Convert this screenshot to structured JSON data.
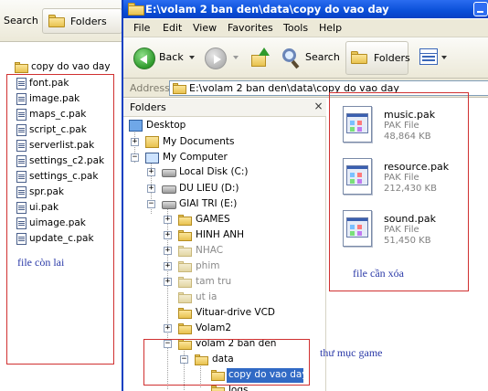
{
  "left_window": {
    "search_label": "Search",
    "folders_label": "Folders",
    "header_item": "copy do vao day",
    "files": [
      "font.pak",
      "image.pak",
      "maps_c.pak",
      "script_c.pak",
      "serverlist.pak",
      "settings_c2.pak",
      "settings_c.pak",
      "spr.pak",
      "ui.pak",
      "uimage.pak",
      "update_c.pak"
    ],
    "annotation": "file còn lai"
  },
  "main_window": {
    "title": "E:\\volam 2 ban den\\data\\copy do vao day",
    "menu": [
      "File",
      "Edit",
      "View",
      "Favorites",
      "Tools",
      "Help"
    ],
    "toolbar": {
      "back_label": "Back",
      "search_label": "Search",
      "folders_label": "Folders"
    },
    "address": {
      "label": "Address",
      "value": "E:\\volam 2 ban den\\data\\copy do vao day"
    },
    "folders_pane": {
      "title": "Folders",
      "close_glyph": "×",
      "tree": [
        {
          "label": "Desktop"
        },
        {
          "label": "My Documents"
        },
        {
          "label": "My Computer"
        },
        {
          "label": "Local Disk (C:)"
        },
        {
          "label": "DU LIEU (D:)"
        },
        {
          "label": "GIAI TRI (E:)"
        },
        {
          "label": "GAMES"
        },
        {
          "label": "HINH ANH"
        },
        {
          "label": "NHAC"
        },
        {
          "label": "phim"
        },
        {
          "label": "tam tru"
        },
        {
          "label": "ut ia"
        },
        {
          "label": "Vituar-drive VCD"
        },
        {
          "label": "Volam2"
        },
        {
          "label": "volam 2 ban den"
        },
        {
          "label": "data"
        },
        {
          "label": "copy do vao day"
        },
        {
          "label": "logs"
        }
      ]
    },
    "files": [
      {
        "name": "music.pak",
        "type": "PAK File",
        "size": "48,864 KB"
      },
      {
        "name": "resource.pak",
        "type": "PAK File",
        "size": "212,430 KB"
      },
      {
        "name": "sound.pak",
        "type": "PAK File",
        "size": "51,450 KB"
      }
    ],
    "annotation_delete": "file cần xóa",
    "annotation_game": "thư mục game"
  },
  "colors": {
    "titlebar": "#0a4fd8",
    "annotation_box": "#d03030",
    "annotation_text": "#2b3aa8",
    "selection": "#316ac5"
  }
}
